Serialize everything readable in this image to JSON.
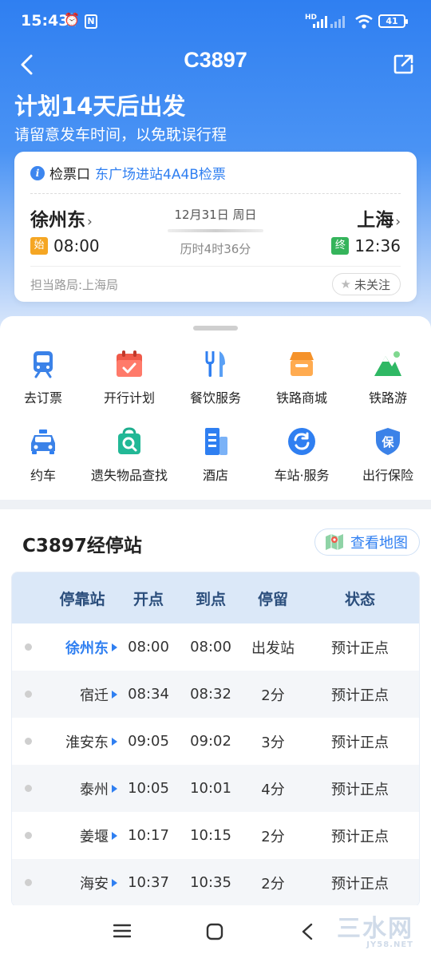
{
  "status_bar": {
    "time": "15:43",
    "battery": "41",
    "network": "HD"
  },
  "header": {
    "title": "C3897"
  },
  "plan": {
    "headline": "计划14天后出发",
    "subtitle": "请留意发车时间，以免耽误行程"
  },
  "trip": {
    "gate_label": "检票口",
    "gate_value": "东广场进站4A4B检票",
    "from_station": "徐州东",
    "to_station": "上海",
    "date": "12月31日 周日",
    "duration": "历时4时36分",
    "depart_tag": "始",
    "depart_time": "08:00",
    "arrive_tag": "终",
    "arrive_time": "12:36",
    "bureau": "担当路局:上海局",
    "follow_label": "未关注"
  },
  "services": [
    {
      "label": "去订票",
      "icon": "train-ticket-icon"
    },
    {
      "label": "开行计划",
      "icon": "calendar-icon"
    },
    {
      "label": "餐饮服务",
      "icon": "fork-knife-icon"
    },
    {
      "label": "铁路商城",
      "icon": "shop-icon"
    },
    {
      "label": "铁路游",
      "icon": "mountain-icon"
    },
    {
      "label": "约车",
      "icon": "taxi-icon"
    },
    {
      "label": "遗失物品查找",
      "icon": "lost-bag-icon"
    },
    {
      "label": "酒店",
      "icon": "hotel-icon"
    },
    {
      "label": "车站·服务",
      "icon": "station-service-icon"
    },
    {
      "label": "出行保险",
      "icon": "insurance-shield-icon"
    }
  ],
  "stops": {
    "title": "C3897经停站",
    "map_button": "查看地图",
    "columns": [
      "停靠站",
      "开点",
      "到点",
      "停留",
      "状态"
    ],
    "rows": [
      {
        "station": "徐州东",
        "depart": "08:00",
        "arrive": "08:00",
        "stay": "出发站",
        "status": "预计正点"
      },
      {
        "station": "宿迁",
        "depart": "08:34",
        "arrive": "08:32",
        "stay": "2分",
        "status": "预计正点"
      },
      {
        "station": "淮安东",
        "depart": "09:05",
        "arrive": "09:02",
        "stay": "3分",
        "status": "预计正点"
      },
      {
        "station": "泰州",
        "depart": "10:05",
        "arrive": "10:01",
        "stay": "4分",
        "status": "预计正点"
      },
      {
        "station": "姜堰",
        "depart": "10:17",
        "arrive": "10:15",
        "stay": "2分",
        "status": "预计正点"
      },
      {
        "station": "海安",
        "depart": "10:37",
        "arrive": "10:35",
        "stay": "2分",
        "status": "预计正点"
      }
    ]
  },
  "watermark": {
    "text": "三水网",
    "url": "JY58.NET"
  },
  "colors": {
    "primary": "#2f7ff1",
    "header_bg": "#dbe8f8",
    "start_tag": "#f5a623",
    "end_tag": "#35b45b"
  }
}
